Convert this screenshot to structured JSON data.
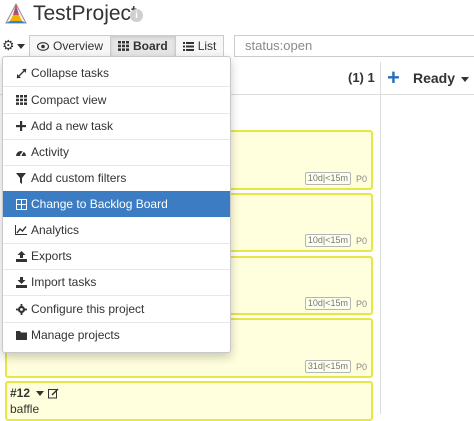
{
  "header": {
    "title": "TestProject",
    "logo_icon": "prism-triangle-logo",
    "info_icon": "i"
  },
  "toolbar": {
    "settings_icon": "⚙",
    "views": [
      {
        "label": "Overview",
        "icon": "eye-icon"
      },
      {
        "label": "Board",
        "icon": "grid-icon",
        "active": true
      },
      {
        "label": "List",
        "icon": "list-icon"
      }
    ],
    "filter_value": "status:open"
  },
  "board": {
    "column_count": "(1) 1",
    "add_symbol": "+",
    "column_title": "Ready",
    "cards": [
      {
        "time_estimate": "10d",
        "time_spent": "<15m",
        "priority": "P0"
      },
      {
        "time_estimate": "10d",
        "time_spent": "<15m",
        "priority": "P0"
      },
      {
        "time_estimate": "10d",
        "time_spent": "<15m",
        "priority": "P0"
      },
      {
        "time_estimate": "31d",
        "time_spent": "<15m",
        "priority": "P0"
      },
      {
        "id": "#12",
        "title": "baffle"
      }
    ]
  },
  "menu": {
    "items": [
      {
        "label": "Collapse tasks",
        "icon": "collapse-icon"
      },
      {
        "label": "Compact view",
        "icon": "grid-icon"
      },
      {
        "label": "Add a new task",
        "icon": "plus-icon"
      },
      {
        "label": "Activity",
        "icon": "dashboard-icon"
      },
      {
        "label": "Add custom filters",
        "icon": "filter-icon"
      },
      {
        "label": "Change to Backlog Board",
        "icon": "board-icon",
        "selected": true
      },
      {
        "label": "Analytics",
        "icon": "line-chart-icon"
      },
      {
        "label": "Exports",
        "icon": "upload-icon"
      },
      {
        "label": "Import tasks",
        "icon": "download-icon"
      },
      {
        "label": "Configure this project",
        "icon": "cog-icon"
      },
      {
        "label": "Manage projects",
        "icon": "folder-icon"
      }
    ],
    "selected_color": "#3c7cc2"
  },
  "colors": {
    "card_background": "#ffffdd",
    "card_border": "#e6e645",
    "accent_blue": "#2a6ebb"
  }
}
